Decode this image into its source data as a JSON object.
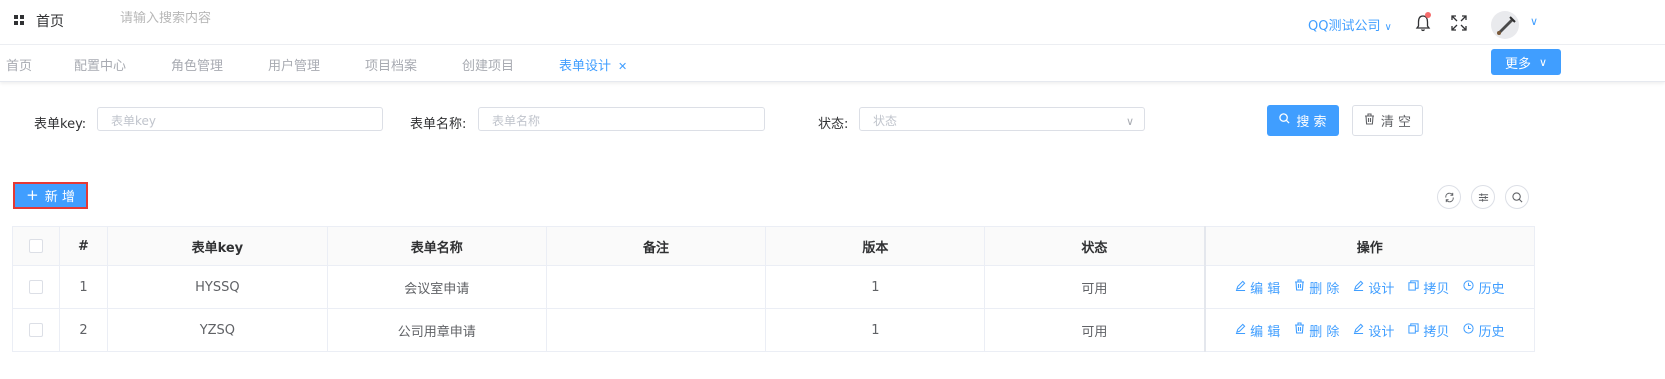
{
  "header": {
    "title": "首页",
    "search_placeholder": "请输入搜索内容",
    "company": "QQ测试公司",
    "icons": [
      "grid-icon",
      "bell-icon",
      "fullscreen-icon",
      "avatar",
      "chevron-down-icon"
    ]
  },
  "tabs": [
    {
      "label": "首页"
    },
    {
      "label": "配置中心"
    },
    {
      "label": "角色管理"
    },
    {
      "label": "用户管理"
    },
    {
      "label": "项目档案"
    },
    {
      "label": "创建项目"
    },
    {
      "label": "表单设计",
      "active": true
    }
  ],
  "tabbar": {
    "more_label": "更多"
  },
  "filters": {
    "key_label": "表单key:",
    "key_placeholder": "表单key",
    "name_label": "表单名称:",
    "name_placeholder": "表单名称",
    "status_label": "状态:",
    "status_placeholder": "状态",
    "search_label": "搜 索",
    "clear_label": "清 空"
  },
  "toolbar": {
    "add_label": "新 增"
  },
  "table": {
    "columns": [
      "#",
      "表单key",
      "表单名称",
      "备注",
      "版本",
      "状态",
      "操作"
    ],
    "rows": [
      {
        "index": "1",
        "key": "HYSSQ",
        "name": "会议室申请",
        "remark": "",
        "version": "1",
        "status": "可用"
      },
      {
        "index": "2",
        "key": "YZSQ",
        "name": "公司用章申请",
        "remark": "",
        "version": "1",
        "status": "可用"
      }
    ],
    "actions": {
      "edit": "编 辑",
      "delete": "删 除",
      "design": "设计",
      "copy": "拷贝",
      "history": "历史"
    }
  },
  "colors": {
    "accent": "#409eff",
    "highlight_border": "#e53935",
    "notify_dot": "#f56c6c"
  }
}
